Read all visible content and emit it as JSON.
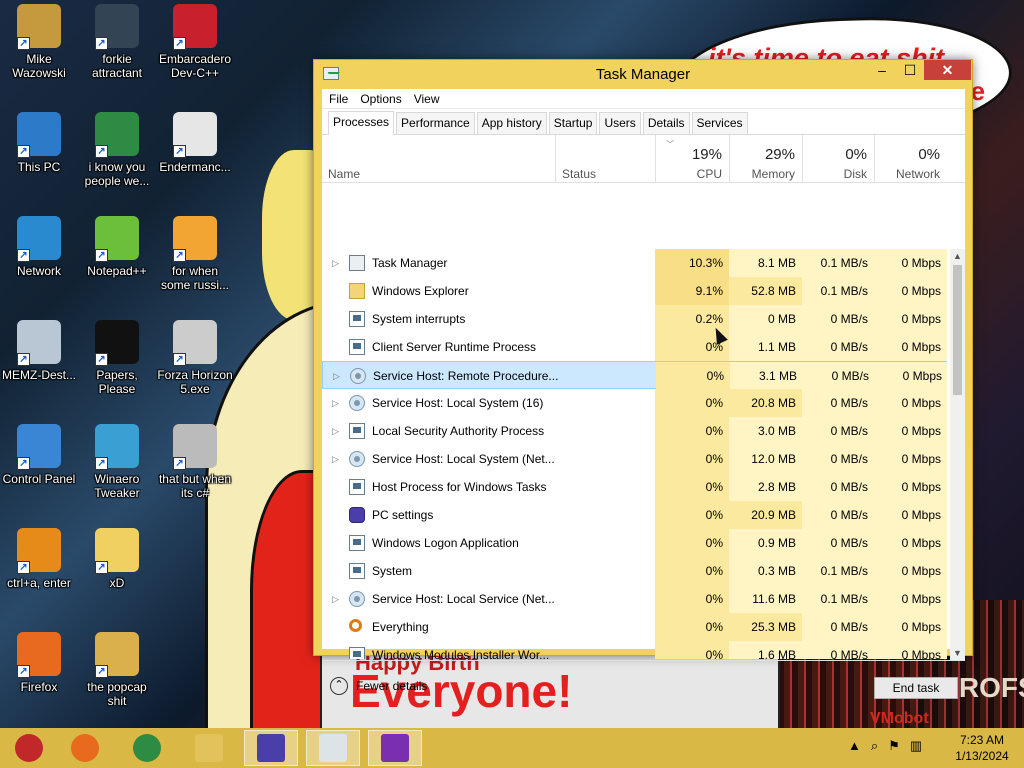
{
  "wallpaper": {
    "bubble_text": "it's time to eat shit",
    "bubble_text_overflow": "te",
    "sign_top": "Happy Birth",
    "sign_text": "Everyone!",
    "corner_text": "VMobot",
    "aero_text": "AEROFS"
  },
  "desktop_icons": [
    {
      "label": "Mike Wazowski",
      "icon": "folder-person-icon",
      "color": "#c59a3e"
    },
    {
      "label": "forkie attractant",
      "icon": "gear-app-icon",
      "color": "#345"
    },
    {
      "label": "Embarcadero Dev-C++",
      "icon": "devcpp-icon",
      "color": "#c8202c"
    },
    {
      "label": "This PC",
      "icon": "computer-icon",
      "color": "#2d7ac9"
    },
    {
      "label": "i know you people we...",
      "icon": "chrome-icon",
      "color": "#2e8b44"
    },
    {
      "label": "Endermanc...",
      "icon": "window-app-icon",
      "color": "#e6e6e6"
    },
    {
      "label": "Network",
      "icon": "network-icon",
      "color": "#2a8ad0"
    },
    {
      "label": "Notepad++",
      "icon": "notepadpp-icon",
      "color": "#6cbf3a"
    },
    {
      "label": "for when some russi...",
      "icon": "pe-icon",
      "color": "#f2a533"
    },
    {
      "label": "MEMZ-Dest...",
      "icon": "recycle-bin-icon",
      "color": "#b9c7d4"
    },
    {
      "label": "Papers, Please",
      "icon": "papers-please-icon",
      "color": "#111"
    },
    {
      "label": "Forza Horizon 5.exe",
      "icon": "flash-icon",
      "color": "#ccc"
    },
    {
      "label": "Control Panel",
      "icon": "control-panel-icon",
      "color": "#3a86d4"
    },
    {
      "label": "Winaero Tweaker",
      "icon": "winaero-icon",
      "color": "#3aa0d4"
    },
    {
      "label": "that but when its c#",
      "icon": "stack-icon",
      "color": "#bbb"
    },
    {
      "label": "ctrl+a, enter",
      "icon": "orange-ring-icon",
      "color": "#e68a1a"
    },
    {
      "label": "xD",
      "icon": "xd-icon",
      "color": "#f0d060"
    },
    {
      "label": "Firefox",
      "icon": "firefox-icon",
      "color": "#e86a1e"
    },
    {
      "label": "the popcap shit",
      "icon": "folder-icon",
      "color": "#d9b04c"
    }
  ],
  "task_manager": {
    "title": "Task Manager",
    "window_buttons": {
      "min": "–",
      "max": "☐",
      "close": "✕"
    },
    "menu": [
      "File",
      "Options",
      "View"
    ],
    "tabs": [
      "Processes",
      "Performance",
      "App history",
      "Startup",
      "Users",
      "Details",
      "Services"
    ],
    "active_tab": "Processes",
    "columns": {
      "name": "Name",
      "status": "Status",
      "cpu": {
        "pct": "19%",
        "label": "CPU"
      },
      "memory": {
        "pct": "29%",
        "label": "Memory"
      },
      "disk": {
        "pct": "0%",
        "label": "Disk"
      },
      "network": {
        "pct": "0%",
        "label": "Network"
      }
    },
    "processes": [
      {
        "name": "Task Manager",
        "expand": "▷",
        "icon": "tm",
        "cpu": "10.3%",
        "memory": "8.1 MB",
        "disk": "0.1 MB/s",
        "network": "0 Mbps"
      },
      {
        "name": "Windows Explorer",
        "expand": "",
        "icon": "folder",
        "cpu": "9.1%",
        "memory": "52.8 MB",
        "disk": "0.1 MB/s",
        "network": "0 Mbps"
      },
      {
        "name": "System interrupts",
        "expand": "",
        "icon": "window",
        "cpu": "0.2%",
        "memory": "0 MB",
        "disk": "0 MB/s",
        "network": "0 Mbps"
      },
      {
        "name": "Client Server Runtime Process",
        "expand": "",
        "icon": "window",
        "cpu": "0%",
        "memory": "1.1 MB",
        "disk": "0 MB/s",
        "network": "0 Mbps"
      },
      {
        "name": "Service Host: Remote Procedure...",
        "expand": "▷",
        "icon": "gear",
        "cpu": "0%",
        "memory": "3.1 MB",
        "disk": "0 MB/s",
        "network": "0 Mbps"
      },
      {
        "name": "Service Host: Local System (16)",
        "expand": "▷",
        "icon": "gear",
        "cpu": "0%",
        "memory": "20.8 MB",
        "disk": "0 MB/s",
        "network": "0 Mbps"
      },
      {
        "name": "Local Security Authority Process",
        "expand": "▷",
        "icon": "window",
        "cpu": "0%",
        "memory": "3.0 MB",
        "disk": "0 MB/s",
        "network": "0 Mbps"
      },
      {
        "name": "Service Host: Local System (Net...",
        "expand": "▷",
        "icon": "gear",
        "cpu": "0%",
        "memory": "12.0 MB",
        "disk": "0 MB/s",
        "network": "0 Mbps"
      },
      {
        "name": "Host Process for Windows Tasks",
        "expand": "",
        "icon": "window",
        "cpu": "0%",
        "memory": "2.8 MB",
        "disk": "0 MB/s",
        "network": "0 Mbps"
      },
      {
        "name": "PC settings",
        "expand": "",
        "icon": "settings",
        "cpu": "0%",
        "memory": "20.9 MB",
        "disk": "0 MB/s",
        "network": "0 Mbps"
      },
      {
        "name": "Windows Logon Application",
        "expand": "",
        "icon": "window",
        "cpu": "0%",
        "memory": "0.9 MB",
        "disk": "0 MB/s",
        "network": "0 Mbps"
      },
      {
        "name": "System",
        "expand": "",
        "icon": "window",
        "cpu": "0%",
        "memory": "0.3 MB",
        "disk": "0.1 MB/s",
        "network": "0 Mbps"
      },
      {
        "name": "Service Host: Local Service (Net...",
        "expand": "▷",
        "icon": "gear",
        "cpu": "0%",
        "memory": "11.6 MB",
        "disk": "0.1 MB/s",
        "network": "0 Mbps"
      },
      {
        "name": "Everything",
        "expand": "",
        "icon": "search",
        "cpu": "0%",
        "memory": "25.3 MB",
        "disk": "0 MB/s",
        "network": "0 Mbps"
      },
      {
        "name": "Windows Modules Installer Wor...",
        "expand": "",
        "icon": "window",
        "cpu": "0%",
        "memory": "1.6 MB",
        "disk": "0 MB/s",
        "network": "0 Mbps"
      }
    ],
    "selected_row": 4,
    "fewer_details": "Fewer details",
    "end_task": "End task"
  },
  "taskbar": {
    "items": [
      {
        "name": "start-ornament",
        "color": "#c0282a"
      },
      {
        "name": "firefox",
        "color": "#e86a1e"
      },
      {
        "name": "chrome",
        "color": "#2e8b44"
      },
      {
        "name": "file-explorer",
        "color": "#e2c25a"
      },
      {
        "name": "pc-settings",
        "color": "#4a3fa8"
      },
      {
        "name": "task-manager",
        "color": "#dce4e8"
      },
      {
        "name": "everything-search",
        "color": "#7a2fb0"
      }
    ],
    "tray": {
      "up": "▲",
      "search": "⌕",
      "flag": "⚑",
      "network": "▥"
    },
    "clock_time": "7:23 AM",
    "clock_date": "1/13/2024"
  }
}
